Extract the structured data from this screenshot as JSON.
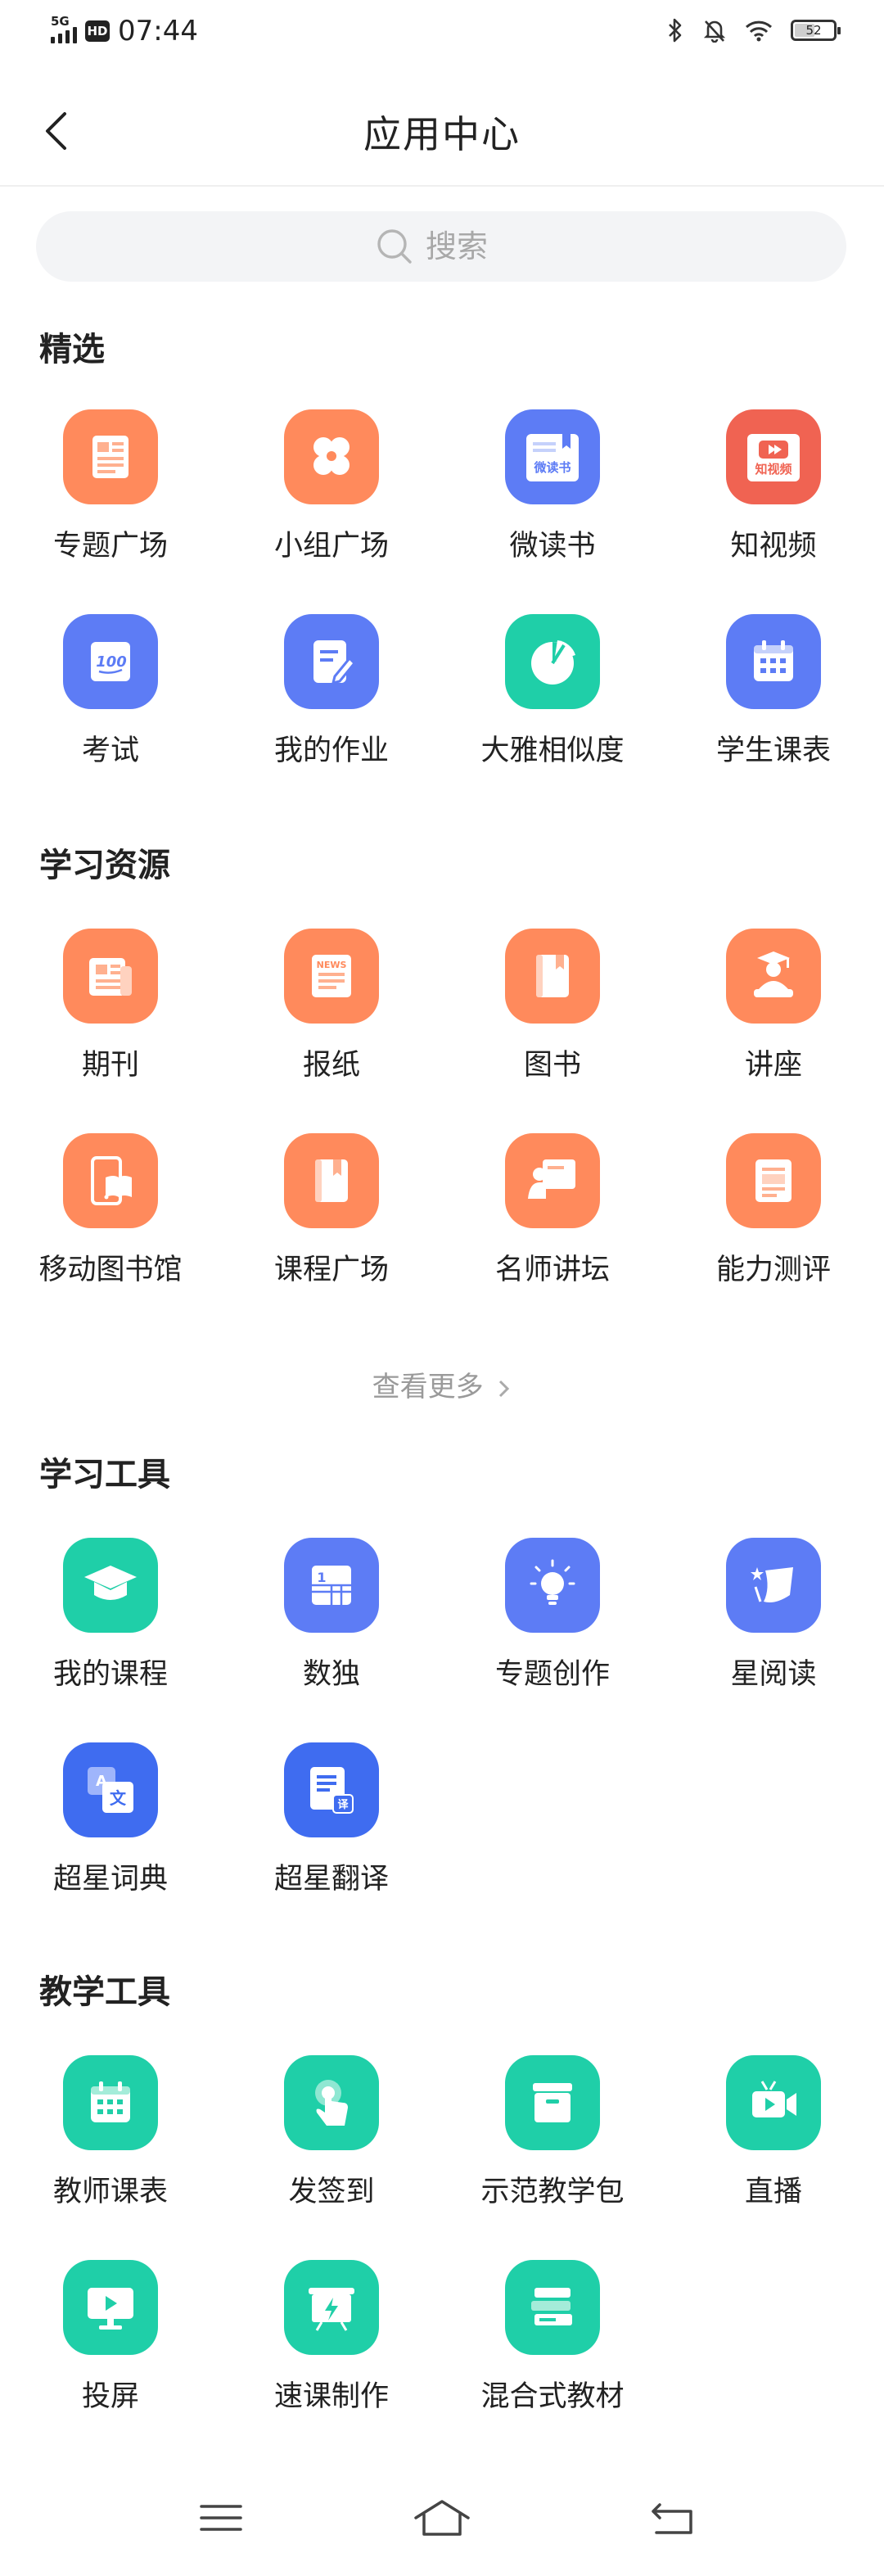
{
  "status": {
    "network": "5G",
    "hd": "HD",
    "time": "07:44",
    "battery": "52"
  },
  "header": {
    "title": "应用中心"
  },
  "search": {
    "placeholder": "搜索"
  },
  "sections": [
    {
      "title": "精选",
      "items": [
        {
          "label": "专题广场",
          "icon": "newspaper-icon",
          "color": "#ff8a5c"
        },
        {
          "label": "小组广场",
          "icon": "group-circles-icon",
          "color": "#ff8a5c"
        },
        {
          "label": "微读书",
          "icon": "micro-book-icon",
          "color": "#5d7cf5",
          "badge": "微读书"
        },
        {
          "label": "知视频",
          "icon": "video-icon",
          "color": "#f06352",
          "badge": "知视频"
        },
        {
          "label": "考试",
          "icon": "exam-100-icon",
          "color": "#5d7cf5",
          "badge": "100"
        },
        {
          "label": "我的作业",
          "icon": "homework-edit-icon",
          "color": "#5d7cf5"
        },
        {
          "label": "大雅相似度",
          "icon": "pie-chart-icon",
          "color": "#1fcfa8"
        },
        {
          "label": "学生课表",
          "icon": "calendar-icon",
          "color": "#5d7cf5"
        }
      ]
    },
    {
      "title": "学习资源",
      "items": [
        {
          "label": "期刊",
          "icon": "journal-icon",
          "color": "#ff8a5c"
        },
        {
          "label": "报纸",
          "icon": "news-icon",
          "color": "#ff8a5c",
          "badge": "NEWS"
        },
        {
          "label": "图书",
          "icon": "book-icon",
          "color": "#ff8a5c"
        },
        {
          "label": "讲座",
          "icon": "lecture-icon",
          "color": "#ff8a5c"
        },
        {
          "label": "移动图书馆",
          "icon": "mobile-library-icon",
          "color": "#ff8a5c"
        },
        {
          "label": "课程广场",
          "icon": "course-book-icon",
          "color": "#ff8a5c"
        },
        {
          "label": "名师讲坛",
          "icon": "teacher-board-icon",
          "color": "#ff8a5c"
        },
        {
          "label": "能力测评",
          "icon": "assessment-icon",
          "color": "#ff8a5c"
        }
      ]
    },
    {
      "title": "学习工具",
      "items": [
        {
          "label": "我的课程",
          "icon": "graduation-cap-icon",
          "color": "#1fcfa8"
        },
        {
          "label": "数独",
          "icon": "sudoku-icon",
          "color": "#5d7cf5",
          "badge": "1"
        },
        {
          "label": "专题创作",
          "icon": "lightbulb-icon",
          "color": "#5d7cf5"
        },
        {
          "label": "星阅读",
          "icon": "star-reading-icon",
          "color": "#5d7cf5"
        },
        {
          "label": "超星词典",
          "icon": "dictionary-icon",
          "color": "#3f6cf0",
          "badge": "文"
        },
        {
          "label": "超星翻译",
          "icon": "translate-icon",
          "color": "#3f6cf0",
          "badge": "译"
        }
      ]
    },
    {
      "title": "教学工具",
      "items": [
        {
          "label": "教师课表",
          "icon": "calendar-icon",
          "color": "#1fcfa8"
        },
        {
          "label": "发签到",
          "icon": "tap-icon",
          "color": "#1fcfa8"
        },
        {
          "label": "示范教学包",
          "icon": "package-icon",
          "color": "#1fcfa8"
        },
        {
          "label": "直播",
          "icon": "live-camera-icon",
          "color": "#1fcfa8"
        },
        {
          "label": "投屏",
          "icon": "screen-cast-icon",
          "color": "#1fcfa8"
        },
        {
          "label": "速课制作",
          "icon": "quick-course-icon",
          "color": "#1fcfa8"
        },
        {
          "label": "混合式教材",
          "icon": "books-stack-icon",
          "color": "#1fcfa8"
        }
      ]
    }
  ],
  "more_label": "查看更多"
}
